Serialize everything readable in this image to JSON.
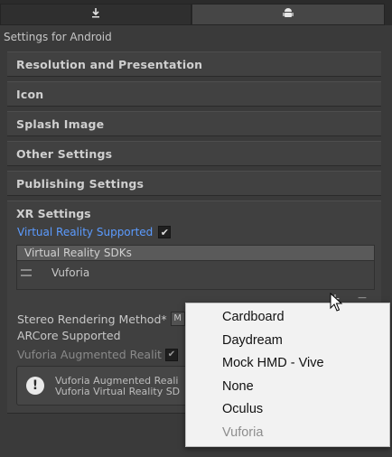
{
  "tabs": [
    {
      "name": "standalone",
      "icon": "download-icon",
      "icon_glyph": "⤓"
    },
    {
      "name": "android",
      "icon": "android-icon",
      "icon_glyph": "⬢"
    }
  ],
  "header_label": "Settings for Android",
  "sections": [
    "Resolution and Presentation",
    "Icon",
    "Splash Image",
    "Other Settings",
    "Publishing Settings"
  ],
  "xr": {
    "title": "XR Settings",
    "vr_supported_label": "Virtual Reality Supported",
    "vr_supported_checked": true,
    "sdk_header": "Virtual Reality SDKs",
    "sdk_items": [
      "Vuforia"
    ],
    "add_symbol": "+",
    "remove_symbol": "−",
    "stereo_label": "Stereo Rendering Method*",
    "stereo_value": "M",
    "arcore_label": "ARCore Supported",
    "vuforia_label": "Vuforia Augmented Realit",
    "help_line_1": "Vuforia Augmented Reali",
    "help_line_2": "Vuforia Virtual Reality SD"
  },
  "dropdown": {
    "options": [
      {
        "label": "Cardboard",
        "enabled": true
      },
      {
        "label": "Daydream",
        "enabled": true
      },
      {
        "label": "Mock HMD - Vive",
        "enabled": true
      },
      {
        "label": "None",
        "enabled": true
      },
      {
        "label": "Oculus",
        "enabled": true
      },
      {
        "label": "Vuforia",
        "enabled": false
      }
    ]
  },
  "colors": {
    "panel_bg": "#3a3a3a",
    "section_bg": "#414141",
    "link_blue": "#5b9bff",
    "dropdown_bg": "#f2f2f2"
  }
}
